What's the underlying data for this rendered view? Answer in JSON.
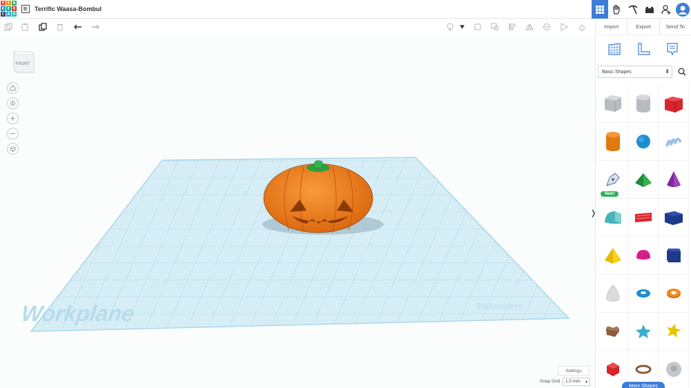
{
  "app": {
    "logo_letters": [
      "T",
      "I",
      "N",
      "K",
      "E",
      "R",
      "C",
      "A",
      "D"
    ],
    "design_title": "Terrific Waasa-Bombul"
  },
  "panel": {
    "tabs": [
      "Import",
      "Export",
      "Send To"
    ],
    "library": "Basic Shapes",
    "new_badge": "New!",
    "more_shapes": "More Shapes"
  },
  "canvas": {
    "viewcube_label": "FRONT",
    "workplane_label": "Workplane",
    "units_label": "Millimeters",
    "settings_label": "Settings",
    "snap_grid_label": "Snap Grid",
    "snap_grid_value": "1.0 mm"
  },
  "colors": {
    "accent": "#3d7dd6",
    "pumpkin": "#f07e1a",
    "stem": "#2e9e42",
    "workplane": "#d8eef6",
    "grid_line": "#9fd3e6"
  }
}
